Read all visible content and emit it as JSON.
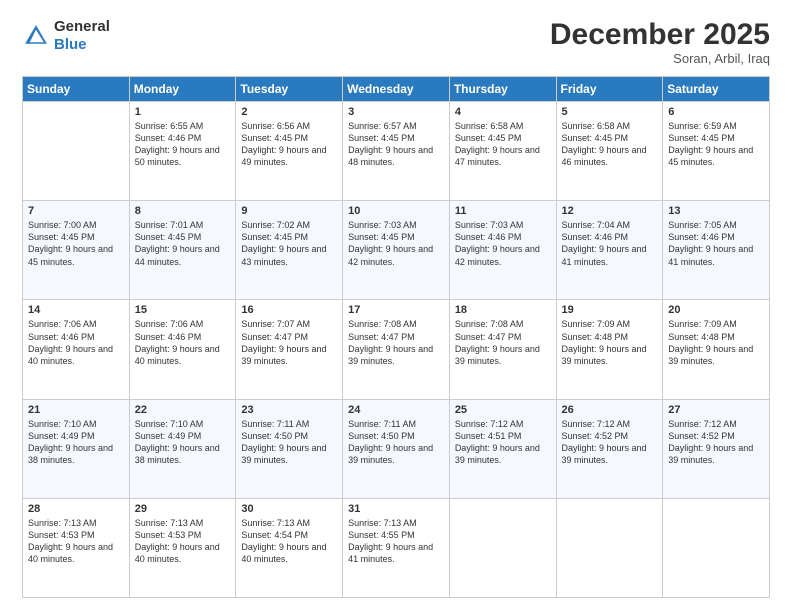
{
  "header": {
    "logo_line1": "General",
    "logo_line2": "Blue",
    "month": "December 2025",
    "location": "Soran, Arbil, Iraq"
  },
  "days_of_week": [
    "Sunday",
    "Monday",
    "Tuesday",
    "Wednesday",
    "Thursday",
    "Friday",
    "Saturday"
  ],
  "weeks": [
    [
      {
        "num": "",
        "sunrise": "",
        "sunset": "",
        "daylight": ""
      },
      {
        "num": "1",
        "sunrise": "Sunrise: 6:55 AM",
        "sunset": "Sunset: 4:46 PM",
        "daylight": "Daylight: 9 hours and 50 minutes."
      },
      {
        "num": "2",
        "sunrise": "Sunrise: 6:56 AM",
        "sunset": "Sunset: 4:45 PM",
        "daylight": "Daylight: 9 hours and 49 minutes."
      },
      {
        "num": "3",
        "sunrise": "Sunrise: 6:57 AM",
        "sunset": "Sunset: 4:45 PM",
        "daylight": "Daylight: 9 hours and 48 minutes."
      },
      {
        "num": "4",
        "sunrise": "Sunrise: 6:58 AM",
        "sunset": "Sunset: 4:45 PM",
        "daylight": "Daylight: 9 hours and 47 minutes."
      },
      {
        "num": "5",
        "sunrise": "Sunrise: 6:58 AM",
        "sunset": "Sunset: 4:45 PM",
        "daylight": "Daylight: 9 hours and 46 minutes."
      },
      {
        "num": "6",
        "sunrise": "Sunrise: 6:59 AM",
        "sunset": "Sunset: 4:45 PM",
        "daylight": "Daylight: 9 hours and 45 minutes."
      }
    ],
    [
      {
        "num": "7",
        "sunrise": "Sunrise: 7:00 AM",
        "sunset": "Sunset: 4:45 PM",
        "daylight": "Daylight: 9 hours and 45 minutes."
      },
      {
        "num": "8",
        "sunrise": "Sunrise: 7:01 AM",
        "sunset": "Sunset: 4:45 PM",
        "daylight": "Daylight: 9 hours and 44 minutes."
      },
      {
        "num": "9",
        "sunrise": "Sunrise: 7:02 AM",
        "sunset": "Sunset: 4:45 PM",
        "daylight": "Daylight: 9 hours and 43 minutes."
      },
      {
        "num": "10",
        "sunrise": "Sunrise: 7:03 AM",
        "sunset": "Sunset: 4:45 PM",
        "daylight": "Daylight: 9 hours and 42 minutes."
      },
      {
        "num": "11",
        "sunrise": "Sunrise: 7:03 AM",
        "sunset": "Sunset: 4:46 PM",
        "daylight": "Daylight: 9 hours and 42 minutes."
      },
      {
        "num": "12",
        "sunrise": "Sunrise: 7:04 AM",
        "sunset": "Sunset: 4:46 PM",
        "daylight": "Daylight: 9 hours and 41 minutes."
      },
      {
        "num": "13",
        "sunrise": "Sunrise: 7:05 AM",
        "sunset": "Sunset: 4:46 PM",
        "daylight": "Daylight: 9 hours and 41 minutes."
      }
    ],
    [
      {
        "num": "14",
        "sunrise": "Sunrise: 7:06 AM",
        "sunset": "Sunset: 4:46 PM",
        "daylight": "Daylight: 9 hours and 40 minutes."
      },
      {
        "num": "15",
        "sunrise": "Sunrise: 7:06 AM",
        "sunset": "Sunset: 4:46 PM",
        "daylight": "Daylight: 9 hours and 40 minutes."
      },
      {
        "num": "16",
        "sunrise": "Sunrise: 7:07 AM",
        "sunset": "Sunset: 4:47 PM",
        "daylight": "Daylight: 9 hours and 39 minutes."
      },
      {
        "num": "17",
        "sunrise": "Sunrise: 7:08 AM",
        "sunset": "Sunset: 4:47 PM",
        "daylight": "Daylight: 9 hours and 39 minutes."
      },
      {
        "num": "18",
        "sunrise": "Sunrise: 7:08 AM",
        "sunset": "Sunset: 4:47 PM",
        "daylight": "Daylight: 9 hours and 39 minutes."
      },
      {
        "num": "19",
        "sunrise": "Sunrise: 7:09 AM",
        "sunset": "Sunset: 4:48 PM",
        "daylight": "Daylight: 9 hours and 39 minutes."
      },
      {
        "num": "20",
        "sunrise": "Sunrise: 7:09 AM",
        "sunset": "Sunset: 4:48 PM",
        "daylight": "Daylight: 9 hours and 39 minutes."
      }
    ],
    [
      {
        "num": "21",
        "sunrise": "Sunrise: 7:10 AM",
        "sunset": "Sunset: 4:49 PM",
        "daylight": "Daylight: 9 hours and 38 minutes."
      },
      {
        "num": "22",
        "sunrise": "Sunrise: 7:10 AM",
        "sunset": "Sunset: 4:49 PM",
        "daylight": "Daylight: 9 hours and 38 minutes."
      },
      {
        "num": "23",
        "sunrise": "Sunrise: 7:11 AM",
        "sunset": "Sunset: 4:50 PM",
        "daylight": "Daylight: 9 hours and 39 minutes."
      },
      {
        "num": "24",
        "sunrise": "Sunrise: 7:11 AM",
        "sunset": "Sunset: 4:50 PM",
        "daylight": "Daylight: 9 hours and 39 minutes."
      },
      {
        "num": "25",
        "sunrise": "Sunrise: 7:12 AM",
        "sunset": "Sunset: 4:51 PM",
        "daylight": "Daylight: 9 hours and 39 minutes."
      },
      {
        "num": "26",
        "sunrise": "Sunrise: 7:12 AM",
        "sunset": "Sunset: 4:52 PM",
        "daylight": "Daylight: 9 hours and 39 minutes."
      },
      {
        "num": "27",
        "sunrise": "Sunrise: 7:12 AM",
        "sunset": "Sunset: 4:52 PM",
        "daylight": "Daylight: 9 hours and 39 minutes."
      }
    ],
    [
      {
        "num": "28",
        "sunrise": "Sunrise: 7:13 AM",
        "sunset": "Sunset: 4:53 PM",
        "daylight": "Daylight: 9 hours and 40 minutes."
      },
      {
        "num": "29",
        "sunrise": "Sunrise: 7:13 AM",
        "sunset": "Sunset: 4:53 PM",
        "daylight": "Daylight: 9 hours and 40 minutes."
      },
      {
        "num": "30",
        "sunrise": "Sunrise: 7:13 AM",
        "sunset": "Sunset: 4:54 PM",
        "daylight": "Daylight: 9 hours and 40 minutes."
      },
      {
        "num": "31",
        "sunrise": "Sunrise: 7:13 AM",
        "sunset": "Sunset: 4:55 PM",
        "daylight": "Daylight: 9 hours and 41 minutes."
      },
      {
        "num": "",
        "sunrise": "",
        "sunset": "",
        "daylight": ""
      },
      {
        "num": "",
        "sunrise": "",
        "sunset": "",
        "daylight": ""
      },
      {
        "num": "",
        "sunrise": "",
        "sunset": "",
        "daylight": ""
      }
    ]
  ]
}
